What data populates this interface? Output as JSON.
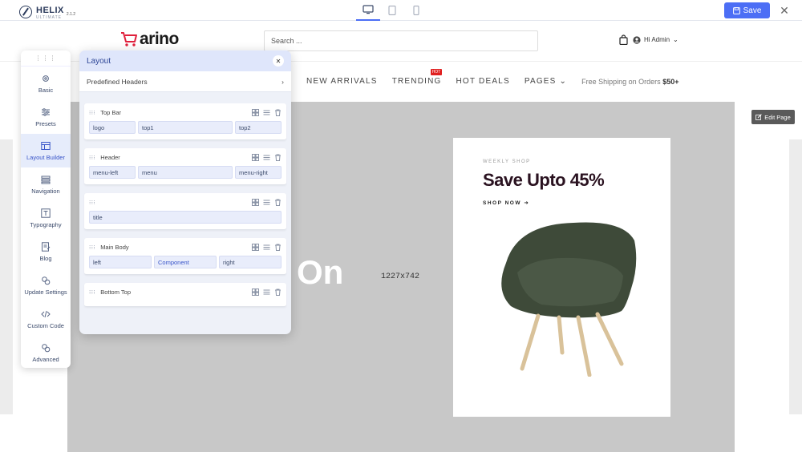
{
  "topbar": {
    "brand_name": "HELIX",
    "brand_sub": "ULTIMATE",
    "version": "2.1.2",
    "devices": [
      "desktop-icon",
      "tablet-icon",
      "mobile-icon"
    ],
    "save_label": "Save",
    "accent": "#4c6ef5"
  },
  "site": {
    "logo_text": "arino",
    "search_placeholder": "Search ...",
    "account_label": "Hi Admin",
    "nav": [
      "NEW ARRIVALS",
      "TRENDING",
      "HOT DEALS",
      "PAGES"
    ],
    "hot_badge": "HOT",
    "shipping_text": "Free Shipping on Orders ",
    "shipping_amount": "$50+"
  },
  "hero": {
    "partial_text": "On",
    "dimension_label": "1227x742",
    "edit_page_label": "Edit Page"
  },
  "promo": {
    "eyebrow": "WEEKLY SHOP",
    "title": "Save Upto 45%",
    "cta": "SHOP NOW"
  },
  "sidebar": {
    "items": [
      {
        "label": "Basic",
        "icon": "gear-icon"
      },
      {
        "label": "Presets",
        "icon": "sliders-icon"
      },
      {
        "label": "Layout Builder",
        "icon": "layout-icon"
      },
      {
        "label": "Navigation",
        "icon": "navigation-icon"
      },
      {
        "label": "Typography",
        "icon": "typography-icon"
      },
      {
        "label": "Blog",
        "icon": "blog-icon"
      },
      {
        "label": "Update Settings",
        "icon": "update-icon"
      },
      {
        "label": "Custom Code",
        "icon": "code-icon"
      },
      {
        "label": "Advanced",
        "icon": "advanced-icon"
      }
    ],
    "active_index": 2
  },
  "panel": {
    "title": "Layout",
    "predefined_label": "Predefined Headers",
    "rows": [
      {
        "name": "Top Bar",
        "cols": [
          "logo",
          "top1",
          "top2"
        ]
      },
      {
        "name": "Header",
        "cols": [
          "menu-left",
          "menu",
          "menu-right"
        ]
      },
      {
        "name": "",
        "cols": [
          "title"
        ]
      },
      {
        "name": "Main Body",
        "cols": [
          "left",
          "Component",
          "right"
        ]
      },
      {
        "name": "Bottom Top",
        "cols": []
      }
    ]
  }
}
